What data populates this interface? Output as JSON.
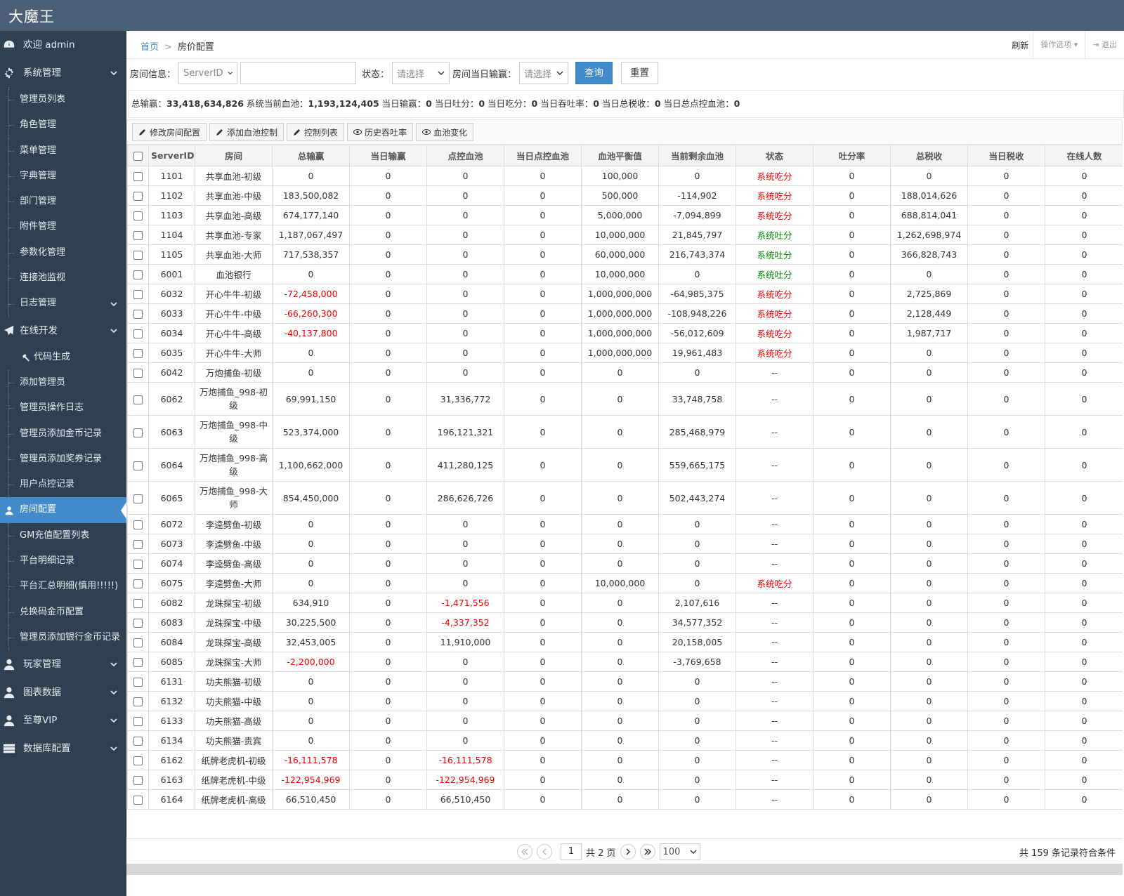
{
  "app": {
    "brand": "大魔王"
  },
  "sidebar": {
    "welcome": "欢迎 admin",
    "system_mgmt": "系统管理",
    "items": [
      "管理员列表",
      "角色管理",
      "菜单管理",
      "字典管理",
      "部门管理",
      "附件管理",
      "参数化管理",
      "连接池监视",
      "日志管理",
      "在线开发",
      "代码生成",
      "添加管理员",
      "管理员操作日志",
      "管理员添加金币记录",
      "管理员添加奖券记录",
      "用户点控记录",
      "房间配置",
      "GM充值配置列表",
      "平台明细记录",
      "平台汇总明细(慎用!!!!!)",
      "兑换码金币配置",
      "管理员添加银行金币记录"
    ],
    "player_mgmt": "玩家管理",
    "chart_data": "图表数据",
    "vip": "至尊VIP",
    "db_config": "数据库配置"
  },
  "breadcrumb": {
    "home": "首页",
    "current": "房价配置"
  },
  "header_right": {
    "refresh": "刷新",
    "options": "操作选项",
    "logout": "退出"
  },
  "search": {
    "room_label": "房间信息：",
    "serverid_select": "ServerID",
    "status_label": "状态：",
    "status_select": "请选择",
    "daily_label": "房间当日输赢：",
    "daily_select": "请选择",
    "query": "查询",
    "reset": "重置"
  },
  "summary": {
    "l1": "总输赢：",
    "v1": "33,418,634,826",
    "l2": " 系统当前血池：",
    "v2": "1,193,124,405",
    "l3": " 当日输赢：",
    "v3": "0",
    "l4": " 当日吐分：",
    "v4": "0",
    "l5": " 当日吃分：",
    "v5": "0",
    "l6": " 当日吞吐率：",
    "v6": "0",
    "l7": " 当日总税收：",
    "v7": "0",
    "l8": " 当日总点控血池：",
    "v8": "0"
  },
  "toolbar": {
    "edit": "修改房间配置",
    "add_pool": "添加血池控制",
    "control_list": "控制列表",
    "history": "历史吞吐率",
    "pool_change": "血池变化"
  },
  "colors": {
    "negative": "#e00000",
    "status_eat": "#e00000",
    "status_spit": "#008a00",
    "accent": "#428bca"
  },
  "table": {
    "headers": [
      "ServerID",
      "房间",
      "总输赢",
      "当日输赢",
      "点控血池",
      "当日点控血池",
      "血池平衡值",
      "当前剩余血池",
      "状态",
      "吐分率",
      "总税收",
      "当日税收",
      "在线人数"
    ],
    "rows": [
      [
        "1101",
        "共享血池-初级",
        "0",
        "0",
        "0",
        "0",
        "100,000",
        "0",
        "系统吃分",
        "0",
        "0",
        "0",
        "0"
      ],
      [
        "1102",
        "共享血池-中级",
        "183,500,082",
        "0",
        "0",
        "0",
        "500,000",
        "-114,902",
        "系统吃分",
        "0",
        "188,014,626",
        "0",
        "0"
      ],
      [
        "1103",
        "共享血池-高级",
        "674,177,140",
        "0",
        "0",
        "0",
        "5,000,000",
        "-7,094,899",
        "系统吃分",
        "0",
        "688,814,041",
        "0",
        "0"
      ],
      [
        "1104",
        "共享血池-专家",
        "1,187,067,497",
        "0",
        "0",
        "0",
        "10,000,000",
        "21,845,797",
        "系统吐分",
        "0",
        "1,262,698,974",
        "0",
        "0"
      ],
      [
        "1105",
        "共享血池-大师",
        "717,538,357",
        "0",
        "0",
        "0",
        "60,000,000",
        "216,743,374",
        "系统吐分",
        "0",
        "366,828,743",
        "0",
        "0"
      ],
      [
        "6001",
        "血池银行",
        "0",
        "0",
        "0",
        "0",
        "10,000,000",
        "0",
        "系统吐分",
        "0",
        "0",
        "0",
        "0"
      ],
      [
        "6032",
        "开心牛牛-初级",
        "-72,458,000",
        "0",
        "0",
        "0",
        "1,000,000,000",
        "-64,985,375",
        "系统吃分",
        "0",
        "2,725,869",
        "0",
        "0"
      ],
      [
        "6033",
        "开心牛牛-中级",
        "-66,260,300",
        "0",
        "0",
        "0",
        "1,000,000,000",
        "-108,948,226",
        "系统吃分",
        "0",
        "2,128,449",
        "0",
        "0"
      ],
      [
        "6034",
        "开心牛牛-高级",
        "-40,137,800",
        "0",
        "0",
        "0",
        "1,000,000,000",
        "-56,012,609",
        "系统吃分",
        "0",
        "1,987,717",
        "0",
        "0"
      ],
      [
        "6035",
        "开心牛牛-大师",
        "0",
        "0",
        "0",
        "0",
        "1,000,000,000",
        "19,961,483",
        "系统吃分",
        "0",
        "0",
        "0",
        "0"
      ],
      [
        "6042",
        "万炮捕鱼-初级",
        "0",
        "0",
        "0",
        "0",
        "0",
        "0",
        "--",
        "0",
        "0",
        "0",
        "0"
      ],
      [
        "6062",
        "万炮捕鱼_998-初级",
        "69,991,150",
        "0",
        "31,336,772",
        "0",
        "0",
        "33,748,758",
        "--",
        "0",
        "0",
        "0",
        "0"
      ],
      [
        "6063",
        "万炮捕鱼_998-中级",
        "523,374,000",
        "0",
        "196,121,321",
        "0",
        "0",
        "285,468,979",
        "--",
        "0",
        "0",
        "0",
        "0"
      ],
      [
        "6064",
        "万炮捕鱼_998-高级",
        "1,100,662,000",
        "0",
        "411,280,125",
        "0",
        "0",
        "559,665,175",
        "--",
        "0",
        "0",
        "0",
        "0"
      ],
      [
        "6065",
        "万炮捕鱼_998-大师",
        "854,450,000",
        "0",
        "286,626,726",
        "0",
        "0",
        "502,443,274",
        "--",
        "0",
        "0",
        "0",
        "0"
      ],
      [
        "6072",
        "李逵劈鱼-初级",
        "0",
        "0",
        "0",
        "0",
        "0",
        "0",
        "--",
        "0",
        "0",
        "0",
        "0"
      ],
      [
        "6073",
        "李逵劈鱼-中级",
        "0",
        "0",
        "0",
        "0",
        "0",
        "0",
        "--",
        "0",
        "0",
        "0",
        "0"
      ],
      [
        "6074",
        "李逵劈鱼-高级",
        "0",
        "0",
        "0",
        "0",
        "0",
        "0",
        "--",
        "0",
        "0",
        "0",
        "0"
      ],
      [
        "6075",
        "李逵劈鱼-大师",
        "0",
        "0",
        "0",
        "0",
        "10,000,000",
        "0",
        "系统吃分",
        "0",
        "0",
        "0",
        "0"
      ],
      [
        "6082",
        "龙珠探宝-初级",
        "634,910",
        "0",
        "-1,471,556",
        "0",
        "0",
        "2,107,616",
        "--",
        "0",
        "0",
        "0",
        "0"
      ],
      [
        "6083",
        "龙珠探宝-中级",
        "30,225,500",
        "0",
        "-4,337,352",
        "0",
        "0",
        "34,577,352",
        "--",
        "0",
        "0",
        "0",
        "0"
      ],
      [
        "6084",
        "龙珠探宝-高级",
        "32,453,005",
        "0",
        "11,910,000",
        "0",
        "0",
        "20,158,005",
        "--",
        "0",
        "0",
        "0",
        "0"
      ],
      [
        "6085",
        "龙珠探宝-大师",
        "-2,200,000",
        "0",
        "0",
        "0",
        "0",
        "-3,769,658",
        "--",
        "0",
        "0",
        "0",
        "0"
      ],
      [
        "6131",
        "功夫熊猫-初级",
        "0",
        "0",
        "0",
        "0",
        "0",
        "0",
        "--",
        "0",
        "0",
        "0",
        "0"
      ],
      [
        "6132",
        "功夫熊猫-中级",
        "0",
        "0",
        "0",
        "0",
        "0",
        "0",
        "--",
        "0",
        "0",
        "0",
        "0"
      ],
      [
        "6133",
        "功夫熊猫-高级",
        "0",
        "0",
        "0",
        "0",
        "0",
        "0",
        "--",
        "0",
        "0",
        "0",
        "0"
      ],
      [
        "6134",
        "功夫熊猫-贵宾",
        "0",
        "0",
        "0",
        "0",
        "0",
        "0",
        "--",
        "0",
        "0",
        "0",
        "0"
      ],
      [
        "6162",
        "纸牌老虎机-初级",
        "-16,111,578",
        "0",
        "-16,111,578",
        "0",
        "0",
        "0",
        "--",
        "0",
        "0",
        "0",
        "0"
      ],
      [
        "6163",
        "纸牌老虎机-中级",
        "-122,954,969",
        "0",
        "-122,954,969",
        "0",
        "0",
        "0",
        "--",
        "0",
        "0",
        "0",
        "0"
      ],
      [
        "6164",
        "纸牌老虎机-高级",
        "66,510,450",
        "0",
        "66,510,450",
        "0",
        "0",
        "0",
        "--",
        "0",
        "0",
        "0",
        "0"
      ]
    ]
  },
  "pager": {
    "page": "1",
    "total_pages": "共 2 页",
    "page_size": "100",
    "total": "共 159 条记录符合条件"
  }
}
